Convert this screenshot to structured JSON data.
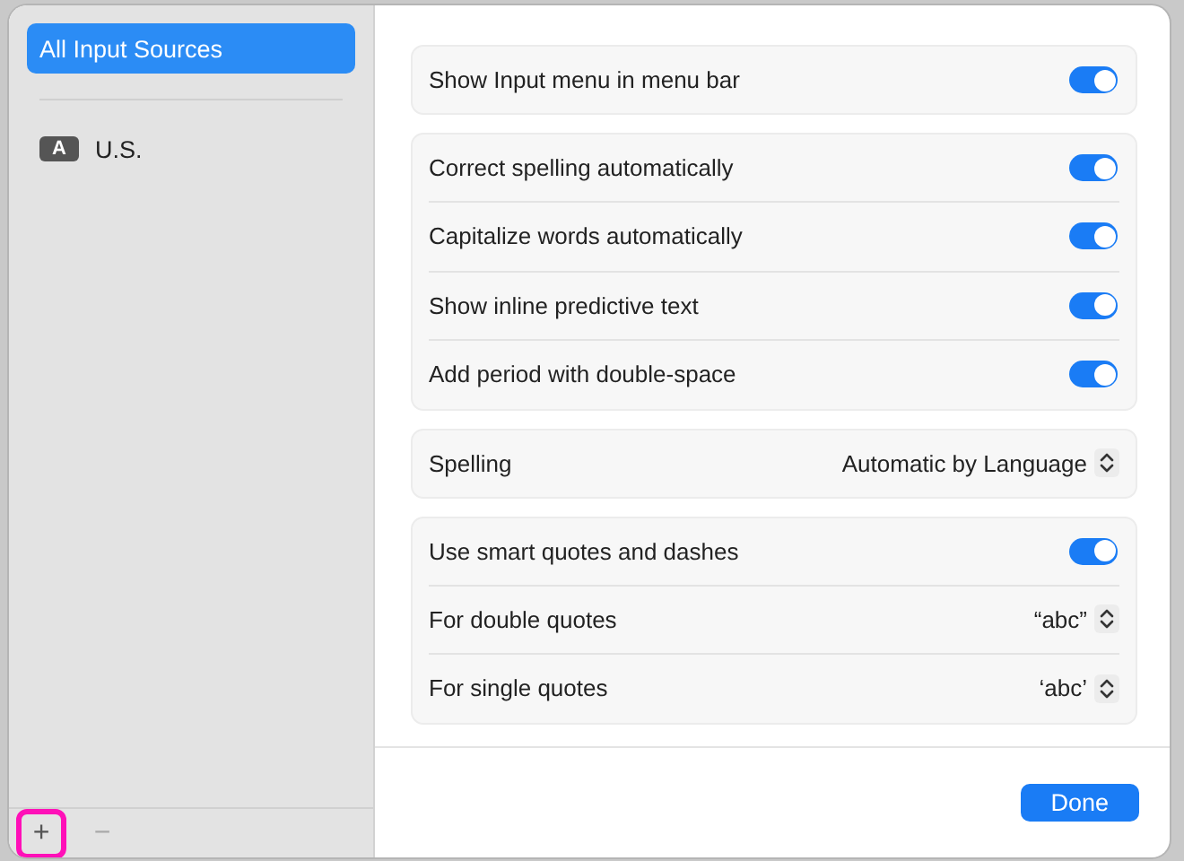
{
  "sidebar": {
    "items": [
      {
        "label": "All Input Sources",
        "selected": true
      },
      {
        "badge": "A",
        "label": "U.S.",
        "selected": false
      }
    ],
    "footer_buttons": [
      {
        "label": "+",
        "disabled": false,
        "highlighted": true
      },
      {
        "label": "−",
        "disabled": true,
        "highlighted": false
      }
    ]
  },
  "groups": [
    [
      {
        "kind": "toggle",
        "label": "Show Input menu in menu bar",
        "on": true
      }
    ],
    [
      {
        "kind": "toggle",
        "label": "Correct spelling automatically",
        "on": true
      },
      {
        "kind": "toggle",
        "label": "Capitalize words automatically",
        "on": true
      },
      {
        "kind": "toggle",
        "label": "Show inline predictive text",
        "on": true
      },
      {
        "kind": "toggle",
        "label": "Add period with double-space",
        "on": true
      }
    ],
    [
      {
        "kind": "popup",
        "label": "Spelling",
        "value": "Automatic by Language"
      }
    ],
    [
      {
        "kind": "toggle",
        "label": "Use smart quotes and dashes",
        "on": true
      },
      {
        "kind": "popup",
        "label": "For double quotes",
        "value": "“abc”"
      },
      {
        "kind": "popup",
        "label": "For single quotes",
        "value": "‘abc’"
      }
    ]
  ],
  "done_button": "Done"
}
